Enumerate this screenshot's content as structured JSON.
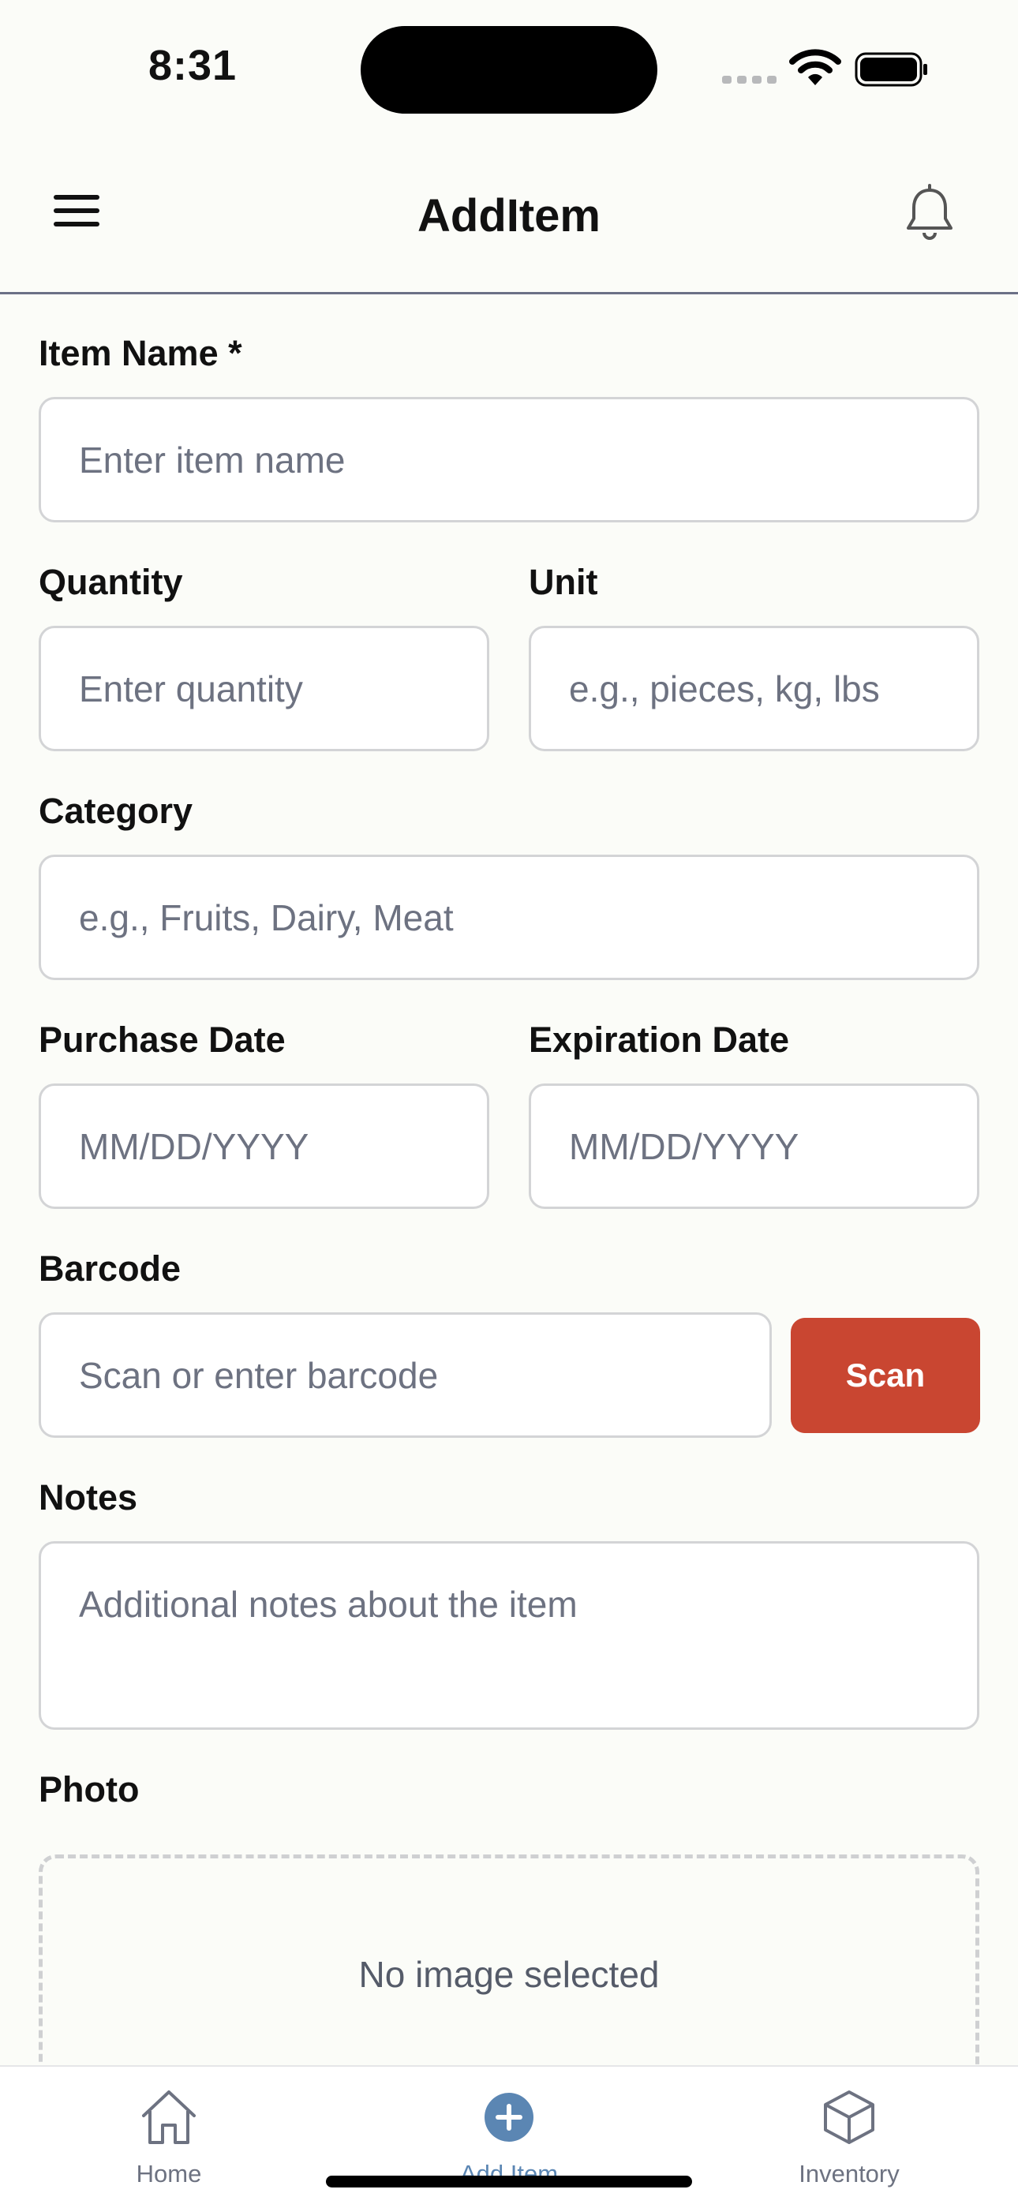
{
  "status_bar": {
    "time": "8:31"
  },
  "header": {
    "title": "AddItem"
  },
  "form": {
    "item_name": {
      "label": "Item Name *",
      "placeholder": "Enter item name"
    },
    "quantity": {
      "label": "Quantity",
      "placeholder": "Enter quantity"
    },
    "unit": {
      "label": "Unit",
      "placeholder": "e.g., pieces, kg, lbs"
    },
    "category": {
      "label": "Category",
      "placeholder": "e.g., Fruits, Dairy, Meat"
    },
    "purchase_date": {
      "label": "Purchase Date",
      "placeholder": "MM/DD/YYYY"
    },
    "expiration_date": {
      "label": "Expiration Date",
      "placeholder": "MM/DD/YYYY"
    },
    "barcode": {
      "label": "Barcode",
      "placeholder": "Scan or enter barcode",
      "scan_label": "Scan"
    },
    "notes": {
      "label": "Notes",
      "placeholder": "Additional notes about the item"
    },
    "photo": {
      "label": "Photo",
      "empty_text": "No image selected"
    }
  },
  "tabs": [
    {
      "label": "Home",
      "icon": "home-icon",
      "active": false
    },
    {
      "label": "Add Item",
      "icon": "plus-circle-icon",
      "active": true
    },
    {
      "label": "Inventory",
      "icon": "cube-icon",
      "active": false
    }
  ],
  "colors": {
    "accent": "#c94631",
    "active_tab": "#5b86b3",
    "background": "#fbfcf8"
  }
}
